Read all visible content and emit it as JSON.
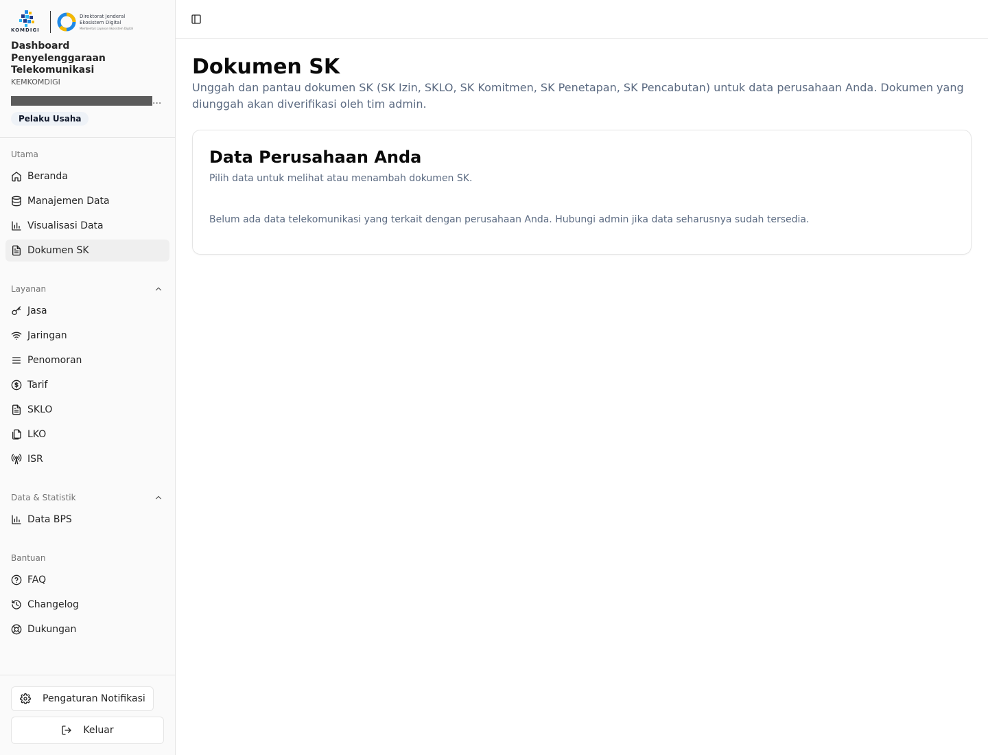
{
  "brand": {
    "logo_text": "KOMDIGI",
    "ditjen_line1": "Direktorat Jenderal",
    "ditjen_line2": "Ekosistem Digital",
    "ditjen_tagline": "Membentuk Layanan Ekosistem Digital",
    "app_title": "Dashboard Penyelenggaraan Telekomunikasi",
    "org": "KEMKOMDIGI"
  },
  "user": {
    "name_ellipsis": "...",
    "role": "Pelaku Usaha"
  },
  "sidebar": {
    "groups": {
      "utama": "Utama",
      "layanan": "Layanan",
      "data_statistik": "Data & Statistik",
      "bantuan": "Bantuan"
    },
    "utama_items": [
      {
        "label": "Beranda",
        "icon": "home-icon"
      },
      {
        "label": "Manajemen Data",
        "icon": "database-icon"
      },
      {
        "label": "Visualisasi Data",
        "icon": "bar-chart-icon"
      },
      {
        "label": "Dokumen SK",
        "icon": "file-text-icon",
        "active": true
      }
    ],
    "layanan_items": [
      {
        "label": "Jasa",
        "icon": "key-icon"
      },
      {
        "label": "Jaringan",
        "icon": "wifi-icon"
      },
      {
        "label": "Penomoran",
        "icon": "list-icon"
      },
      {
        "label": "Tarif",
        "icon": "dollar-circle-icon"
      },
      {
        "label": "SKLO",
        "icon": "file-text-icon"
      },
      {
        "label": "LKO",
        "icon": "copy-icon"
      },
      {
        "label": "ISR",
        "icon": "radio-tower-icon"
      }
    ],
    "data_items": [
      {
        "label": "Data BPS",
        "icon": "bar-chart-icon"
      }
    ],
    "bantuan_items": [
      {
        "label": "FAQ",
        "icon": "help-circle-icon"
      },
      {
        "label": "Changelog",
        "icon": "history-icon"
      },
      {
        "label": "Dukungan",
        "icon": "life-buoy-icon"
      }
    ],
    "notif_label": "Pengaturan Notifikasi",
    "logout_label": "Keluar"
  },
  "main": {
    "title": "Dokumen SK",
    "description": "Unggah dan pantau dokumen SK (SK Izin, SKLO, SK Komitmen, SK Penetapan, SK Pencabutan) untuk data perusahaan Anda. Dokumen yang diunggah akan diverifikasi oleh tim admin.",
    "card": {
      "title": "Data Perusahaan Anda",
      "subtitle": "Pilih data untuk melihat atau menambah dokumen SK.",
      "empty_message": "Belum ada data telekomunikasi yang terkait dengan perusahaan Anda. Hubungi admin jika data seharusnya sudah tersedia."
    }
  },
  "colors": {
    "accent_blue": "#1e88e5",
    "accent_yellow": "#f5b800",
    "muted_text": "#5c6b82"
  }
}
